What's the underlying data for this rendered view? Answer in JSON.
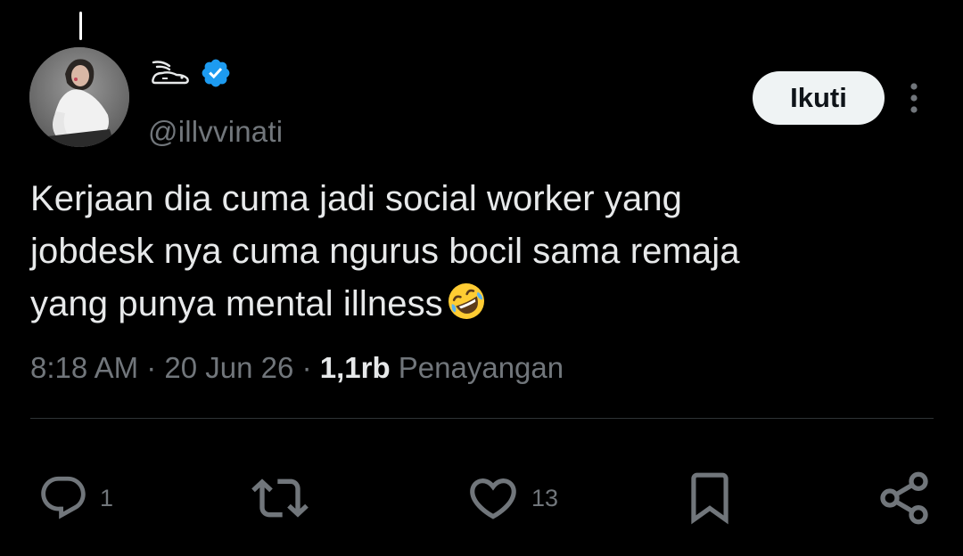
{
  "tweet": {
    "author": {
      "display_name_icon": "rabbit-logo-icon",
      "verified_icon": "verified-badge-icon",
      "handle": "@illvvinati"
    },
    "follow_label": "Ikuti",
    "more_icon": "more-vertical-icon",
    "text": {
      "line1": "Kerjaan dia cuma jadi social worker yang",
      "line2": "jobdesk nya cuma ngurus bocil sama remaja",
      "line3": "yang punya mental illness",
      "emoji": "rolling-on-the-floor-laughing-emoji"
    },
    "meta": {
      "time": "8:18 AM",
      "date": "20 Jun 26",
      "views_count": "1,1rb",
      "views_label": "Penayangan",
      "separator": "·"
    },
    "actions": {
      "reply_count": "1",
      "repost_count": "",
      "like_count": "13"
    },
    "colors": {
      "background": "#000000",
      "text": "#e7e9ea",
      "muted": "#71767b",
      "verified": "#1d9bf0",
      "divider": "#2f3336",
      "follow_bg": "#eff3f4"
    }
  }
}
